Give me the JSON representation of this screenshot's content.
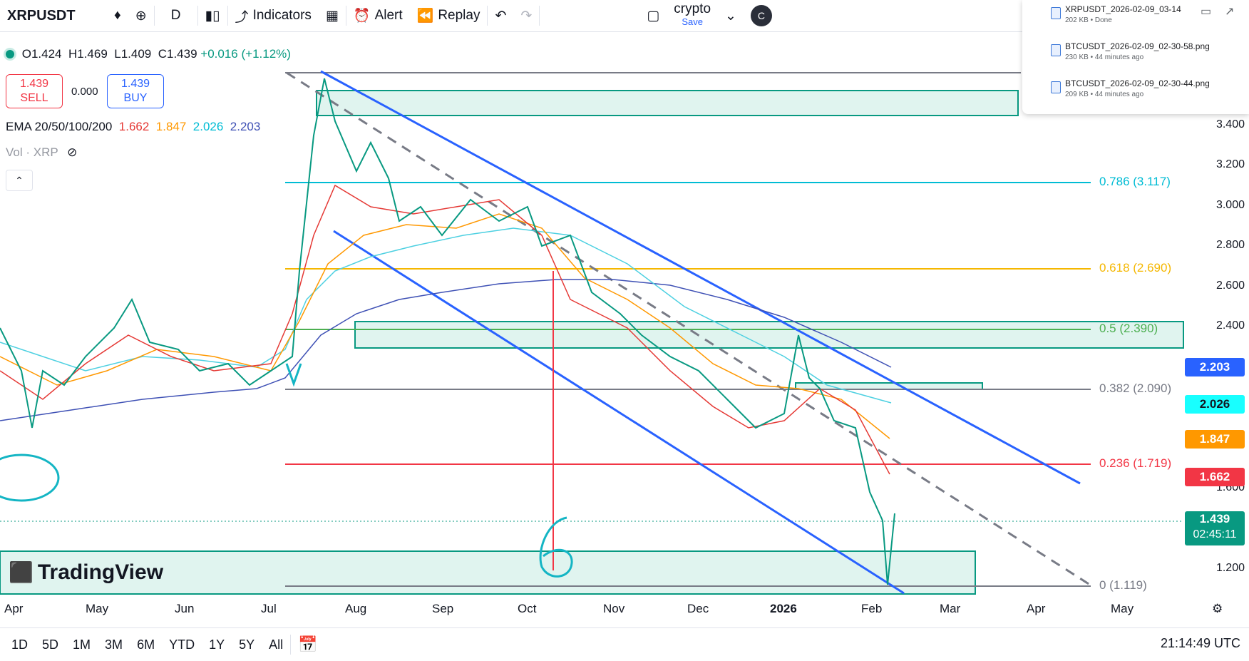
{
  "toolbar": {
    "symbol": "XRPUSDT",
    "interval": "D",
    "indicators": "Indicators",
    "alert": "Alert",
    "replay": "Replay",
    "layout_name": "crypto",
    "save": "Save",
    "avatar": "C"
  },
  "legend": {
    "ohlc": {
      "O": "1.424",
      "H": "1.469",
      "L": "1.409",
      "C": "1.439"
    },
    "change": "+0.016 (+1.12%)",
    "sell_price": "1.439",
    "sell_label": "SELL",
    "spread": "0.000",
    "buy_price": "1.439",
    "buy_label": "BUY",
    "ema_label": "EMA 20/50/100/200",
    "ema_values": [
      "1.662",
      "1.847",
      "2.026",
      "2.203"
    ],
    "vol_label": "Vol · XRP"
  },
  "price_axis": [
    "3.400",
    "3.200",
    "3.000",
    "2.800",
    "2.600",
    "2.400",
    "1.600",
    "1.200"
  ],
  "price_tags": {
    "ema200": "2.203",
    "ema100": "2.026",
    "ema50": "1.847",
    "ema20": "1.662",
    "last": "1.439",
    "countdown": "02:45:11"
  },
  "fib_levels": [
    {
      "label": "0.786 (3.117)",
      "color": "#00bcd4"
    },
    {
      "label": "0.618 (2.690)",
      "color": "#f5b700"
    },
    {
      "label": "0.5 (2.390)",
      "color": "#4caf50"
    },
    {
      "label": "0.382 (2.090)",
      "color": "#787b86"
    },
    {
      "label": "0.236 (1.719)",
      "color": "#f23645"
    },
    {
      "label": "0 (1.119)",
      "color": "#787b86"
    }
  ],
  "x_axis": [
    "Apr",
    "May",
    "Jun",
    "Jul",
    "Aug",
    "Sep",
    "Oct",
    "Nov",
    "Dec",
    "2026",
    "Feb",
    "Mar",
    "Apr",
    "May"
  ],
  "annotation_number": "6",
  "watermark": "TradingView",
  "ranges": [
    "1D",
    "5D",
    "1M",
    "3M",
    "6M",
    "YTD",
    "1Y",
    "5Y",
    "All"
  ],
  "clock": "21:14:49 UTC",
  "downloads": [
    {
      "name": "XRPUSDT_2026-02-09_03-14",
      "meta": "202 KB • Done"
    },
    {
      "name": "BTCUSDT_2026-02-09_02-30-58.png",
      "meta": "230 KB • 44 minutes ago"
    },
    {
      "name": "BTCUSDT_2026-02-09_02-30-44.png",
      "meta": "209 KB • 44 minutes ago"
    }
  ]
}
